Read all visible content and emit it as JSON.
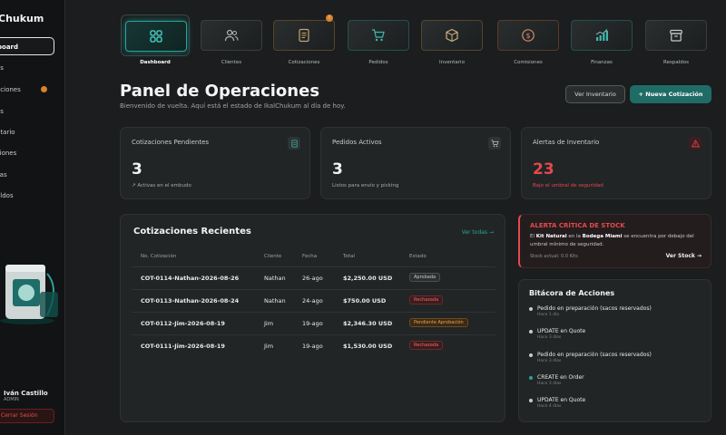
{
  "app": {
    "brand": "Chukum"
  },
  "sidebar": {
    "items": [
      {
        "label": "board",
        "active": true
      },
      {
        "label": "es"
      },
      {
        "label": "aciones",
        "badge": true
      },
      {
        "label": "os"
      },
      {
        "label": "ntario"
      },
      {
        "label": "siones"
      },
      {
        "label": "zas"
      },
      {
        "label": "aldos"
      }
    ],
    "user": {
      "name": "Iván Castillo",
      "role": "ADMIN"
    },
    "logout_label": "Cerrar Sesión"
  },
  "modules": [
    {
      "label": "Dashboard",
      "icon": "grid-icon",
      "active": true
    },
    {
      "label": "Clientes",
      "icon": "users-icon"
    },
    {
      "label": "Cotizaciones",
      "icon": "document-icon",
      "badge": true
    },
    {
      "label": "Pedidos",
      "icon": "cart-icon"
    },
    {
      "label": "Inventario",
      "icon": "box-icon"
    },
    {
      "label": "Comisiones",
      "icon": "dollar-icon"
    },
    {
      "label": "Finanzas",
      "icon": "chart-icon"
    },
    {
      "label": "Respaldos",
      "icon": "archive-icon"
    }
  ],
  "header": {
    "title": "Panel de Operaciones",
    "subtitle": "Bienvenido de vuelta. Aquí está el estado de IkalChukum al día de hoy.",
    "inventory_button": "Ver Inventario",
    "new_quote_button": "+ Nueva Cotización"
  },
  "stats": [
    {
      "title": "Cotizaciones Pendientes",
      "value": "3",
      "sub": "↗ Activas en el embudo",
      "icon": "document-icon"
    },
    {
      "title": "Pedidos Activos",
      "value": "3",
      "sub": "Listos para envío y picking",
      "icon": "cart-icon"
    },
    {
      "title": "Alertas de Inventario",
      "value": "23",
      "sub": "Bajo el umbral de seguridad",
      "icon": "warning-icon",
      "alert": true
    }
  ],
  "quotes": {
    "title": "Cotizaciones Recientes",
    "see_all": "Ver todas →",
    "columns": [
      "No. Cotización",
      "Cliente",
      "Fecha",
      "Total",
      "Estado"
    ],
    "rows": [
      {
        "id": "COT-0114-Nathan-2026-08-26",
        "client": "Nathan",
        "date": "26-ago",
        "total": "$2,250.00 USD",
        "status": "Aprobada",
        "kind": "ok"
      },
      {
        "id": "COT-0113-Nathan-2026-08-24",
        "client": "Nathan",
        "date": "24-ago",
        "total": "$750.00 USD",
        "status": "Rechazada",
        "kind": "rej"
      },
      {
        "id": "COT-0112-Jim-2026-08-19",
        "client": "Jim",
        "date": "19-ago",
        "total": "$2,346.30 USD",
        "status": "Pendiente Aprobación",
        "kind": "pend"
      },
      {
        "id": "COT-0111-Jim-2026-08-19",
        "client": "Jim",
        "date": "19-ago",
        "total": "$1,530.00 USD",
        "status": "Rechazada",
        "kind": "rej"
      }
    ]
  },
  "stock_alert": {
    "title": "ALERTA CRÍTICA DE STOCK",
    "body_pre": "El ",
    "product": "Kit Natural",
    "body_mid": " en la ",
    "warehouse": "Bodega Miami",
    "body_post": " se encuentra por debajo del umbral mínimo de seguridad.",
    "stock_text": "Stock actual: 0.0 Kits",
    "link": "Ver Stock →"
  },
  "log": {
    "title": "Bitácora de Acciones",
    "items": [
      {
        "text": "Pedido en preparación (sacos reservados)",
        "time": "Hace 1 día"
      },
      {
        "text": "UPDATE en Quote",
        "time": "Hace 3 días"
      },
      {
        "text": "Pedido en preparación (sacos reservados)",
        "time": "Hace 3 días"
      },
      {
        "text": "CREATE en Order",
        "time": "Hace 3 días",
        "green": true
      },
      {
        "text": "UPDATE en Quote",
        "time": "Hace 4 días"
      }
    ]
  },
  "colors": {
    "accent": "#2aa39a",
    "danger": "#e5484d",
    "warning": "#d9822b"
  }
}
